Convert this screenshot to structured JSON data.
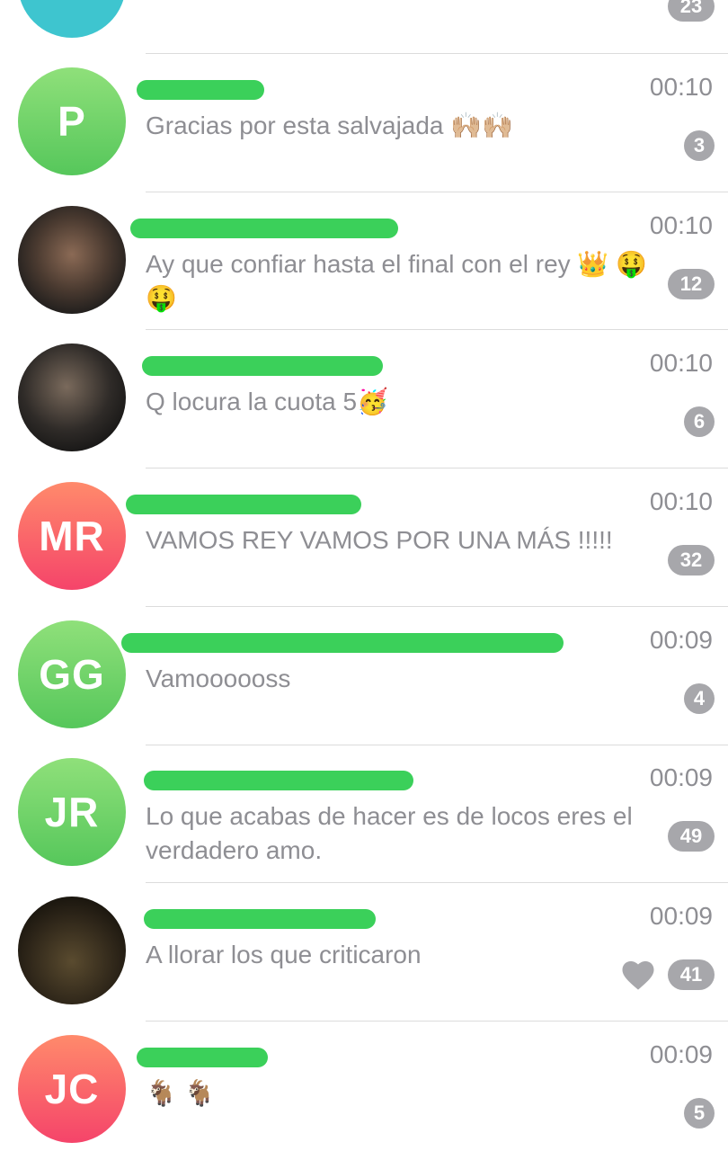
{
  "top_partial": {
    "badge": "23"
  },
  "chats": [
    {
      "initials": "P",
      "avatar_style": "green",
      "time": "00:10",
      "preview": "Gracias por esta salvajada 🙌🏼🙌🏼",
      "unread": "3"
    },
    {
      "initials": "",
      "avatar_style": "photo",
      "time": "00:10",
      "preview": "Ay que confiar hasta el final con el rey 👑 🤑 🤑",
      "unread": "12"
    },
    {
      "initials": "",
      "avatar_style": "photo",
      "time": "00:10",
      "preview": "Q locura la cuota 5🥳",
      "unread": "6"
    },
    {
      "initials": "MR",
      "avatar_style": "red",
      "time": "00:10",
      "preview": "VAMOS REY VAMOS POR UNA MÁS !!!!!",
      "unread": "32"
    },
    {
      "initials": "GG",
      "avatar_style": "green",
      "time": "00:09",
      "preview": "Vamoooooss",
      "unread": "4"
    },
    {
      "initials": "JR",
      "avatar_style": "green",
      "time": "00:09",
      "preview": "Lo que acabas de hacer es de locos eres el verdadero amo.",
      "unread": "49"
    },
    {
      "initials": "",
      "avatar_style": "photo",
      "time": "00:09",
      "preview": "A llorar los que criticaron",
      "unread": "41",
      "icon": "heart-icon"
    },
    {
      "initials": "JC",
      "avatar_style": "red",
      "time": "00:09",
      "preview": "🐐 🐐",
      "unread": "5"
    }
  ]
}
